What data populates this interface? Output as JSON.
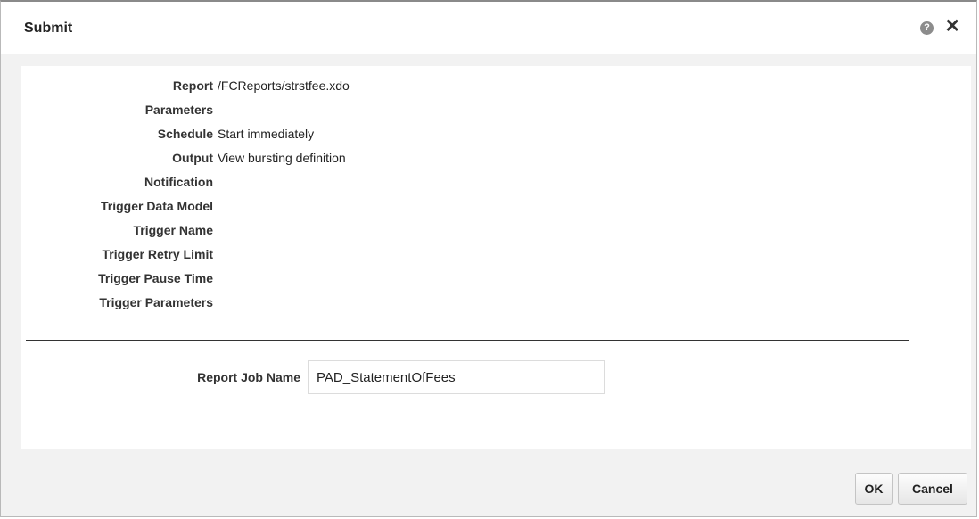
{
  "dialog": {
    "title": "Submit",
    "help_glyph": "?",
    "close_glyph": "✕",
    "help_icon": "help-icon",
    "close_icon": "close-icon"
  },
  "summary": [
    {
      "label": "Report",
      "value": "/FCReports/strstfee.xdo"
    },
    {
      "label": "Parameters",
      "value": ""
    },
    {
      "label": "Schedule",
      "value": "Start immediately"
    },
    {
      "label": "Output",
      "value": "View bursting definition"
    },
    {
      "label": "Notification",
      "value": ""
    },
    {
      "label": "Trigger Data Model",
      "value": ""
    },
    {
      "label": "Trigger Name",
      "value": ""
    },
    {
      "label": "Trigger Retry Limit",
      "value": ""
    },
    {
      "label": "Trigger Pause Time",
      "value": ""
    },
    {
      "label": "Trigger Parameters",
      "value": ""
    }
  ],
  "job": {
    "label": "Report Job Name",
    "value": "PAD_StatementOfFees"
  },
  "buttons": {
    "ok": "OK",
    "cancel": "Cancel"
  }
}
